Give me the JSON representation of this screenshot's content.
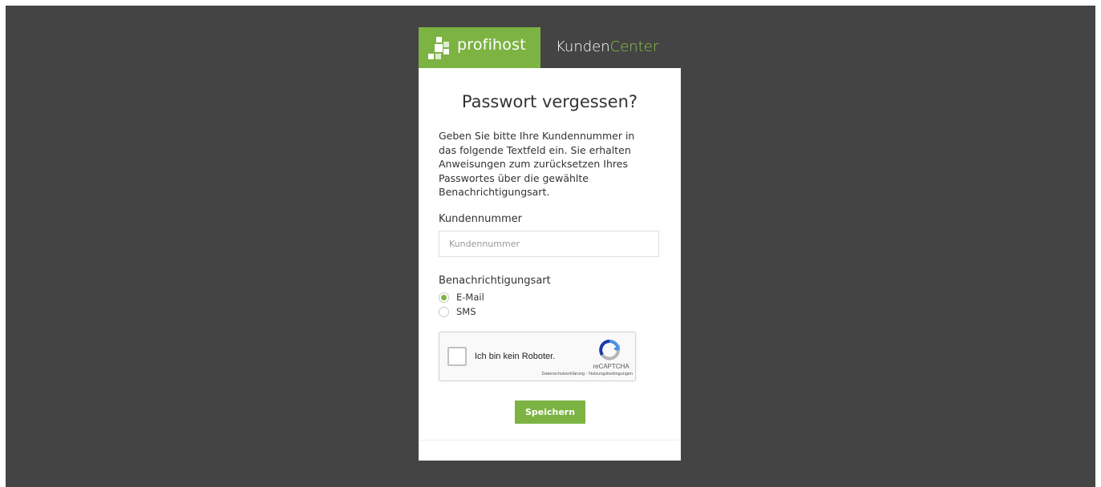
{
  "brand": {
    "logo_text": "profihost",
    "app_name_part1": "Kunden",
    "app_name_part2": "Center"
  },
  "form": {
    "title": "Passwort vergessen?",
    "intro": "Geben Sie bitte Ihre Kundennummer in das folgende Textfeld ein. Sie erhalten Anweisungen zum zurücksetzen Ihres Passwortes über die gewählte Benachrichtigungsart.",
    "customer_number": {
      "label": "Kundennummer",
      "placeholder": "Kundennummer",
      "value": ""
    },
    "notification": {
      "label": "Benachrichtigungsart",
      "options": [
        {
          "label": "E-Mail",
          "selected": true
        },
        {
          "label": "SMS",
          "selected": false
        }
      ]
    },
    "captcha": {
      "label": "Ich bin kein Roboter.",
      "brand": "reCAPTCHA",
      "links": "Datenschutzerklärung - Nutzungsbedingungen",
      "checked": false
    },
    "submit_label": "Speichern"
  },
  "colors": {
    "page_background": "#444444",
    "accent": "#7cb342",
    "card_background": "#ffffff"
  },
  "icons": [
    "profihost-logo-icon",
    "recaptcha-icon"
  ]
}
